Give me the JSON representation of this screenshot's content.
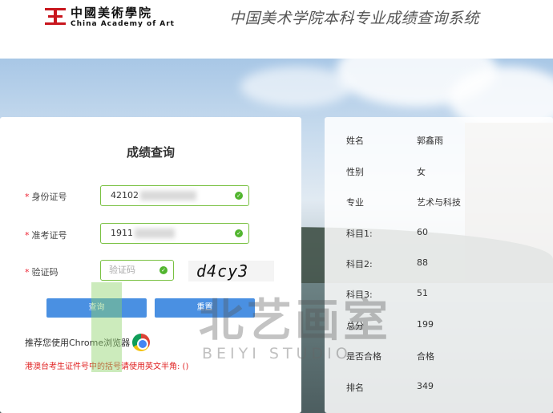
{
  "header": {
    "logo_cn": "中國美術學院",
    "logo_en": "China Academy of Art",
    "system_title": "中国美术学院本科专业成绩查询系统"
  },
  "query": {
    "title": "成绩查询",
    "required_mark": "*",
    "id_label": "身份证号",
    "id_value": "42102",
    "exam_label": "准考证号",
    "exam_value": "1911",
    "captcha_label": "验证码",
    "captcha_placeholder": "验证码",
    "captcha_image_text": "d4cy3",
    "query_button": "查询",
    "reset_button": "重置",
    "recommend_text": "推荐您使用Chrome浏览器",
    "notice_text": "港澳台考生证件号中的括号请使用英文半角: ()"
  },
  "result": {
    "rows": [
      {
        "label": "姓名",
        "value": "郭鑫雨"
      },
      {
        "label": "性别",
        "value": "女"
      },
      {
        "label": "专业",
        "value": "艺术与科技"
      },
      {
        "label": "科目1:",
        "value": "60"
      },
      {
        "label": "科目2:",
        "value": "88"
      },
      {
        "label": "科目3:",
        "value": "51"
      },
      {
        "label": "总分",
        "value": "199"
      },
      {
        "label": "是否合格",
        "value": "合格"
      },
      {
        "label": "排名",
        "value": "349"
      }
    ]
  },
  "watermark": {
    "text": "北艺画室",
    "subtext": "BEIYI STUDIO"
  },
  "colors": {
    "accent_green": "#7ac143",
    "button_blue": "#4a90e2",
    "notice_red": "#e02020",
    "logo_red": "#c8161d"
  },
  "icons": [
    "academy-logo-icon",
    "check-icon",
    "chrome-icon"
  ]
}
